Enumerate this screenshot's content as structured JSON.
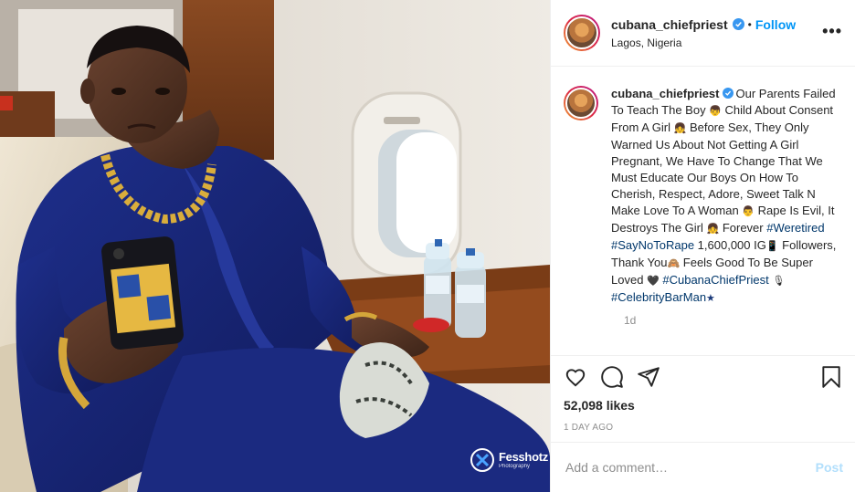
{
  "post": {
    "username": "cubana_chiefpriest",
    "follow_label": "Follow",
    "separator": "•",
    "location": "Lagos, Nigeria",
    "more_icon": "more-horizontal-icon",
    "more_label": "•••"
  },
  "photo": {
    "watermark_name": "Fesshotz",
    "watermark_sub": "Photography"
  },
  "caption": {
    "username": "cubana_chiefpriest",
    "part1": "Our Parents Failed To Teach The Boy ",
    "part2": " Child About Consent From A Girl ",
    "part3": " Before Sex, They Only Warned Us About Not Getting A Girl Pregnant, We Have To Change That We Must Educate Our Boys On How To Cherish, Respect, Adore, Sweet Talk N Make Love To A Woman ",
    "part4": " Rape Is Evil, It Destroys The Girl ",
    "part5": " Forever ",
    "hashtag1": "#Weretired",
    "hashtag2": "#SayNoToRape",
    "part6": " 1,600,000 IG",
    "part7": " Followers, Thank You",
    "part8": " Feels Good To Be Super Loved ",
    "hashtag3": "#CubanaChiefPriest",
    "hashtag4": "#CelebrityBarMan",
    "emoji_boy": "👦",
    "emoji_girl": "👧",
    "emoji_man": "👨",
    "emoji_phone": "📱",
    "emoji_love": "🙈",
    "emoji_heart": "🖤",
    "emoji_mic": "🎙",
    "emoji_star": "★",
    "time_ago": "1d"
  },
  "actions": {
    "likes": "52,098 likes",
    "date": "1 DAY AGO",
    "icons": [
      "heart-icon",
      "comment-icon",
      "share-icon",
      "bookmark-icon"
    ]
  },
  "comment": {
    "placeholder": "Add a comment…",
    "post_label": "Post"
  },
  "colors": {
    "accent": "#0095f6",
    "hashtag": "#00376b",
    "muted": "#8e8e8e",
    "post_disabled": "#b2dffc",
    "verified": "#3897f0"
  }
}
